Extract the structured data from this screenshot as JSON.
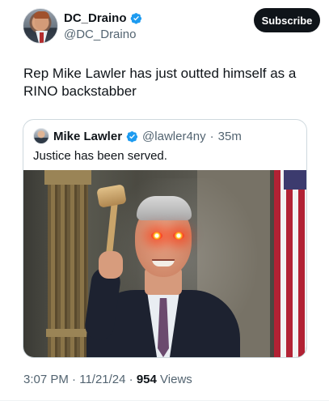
{
  "author": {
    "display_name": "DC_Draino",
    "handle": "@DC_Draino",
    "verified": true
  },
  "subscribe_label": "Subscribe",
  "tweet_text": "Rep Mike Lawler has just outted himself as a RINO backstabber",
  "quoted_tweet": {
    "display_name": "Mike Lawler",
    "handle": "@lawler4ny",
    "separator": "·",
    "time_ago": "35m",
    "text": "Justice has been served.",
    "verified": true
  },
  "meta": {
    "time": "3:07 PM",
    "separator": "·",
    "date": "11/21/24",
    "views_count": "954",
    "views_label": "Views"
  },
  "colors": {
    "verified_blue": "#1d9bf0",
    "secondary_text": "#536471",
    "button_bg": "#0f1419"
  }
}
